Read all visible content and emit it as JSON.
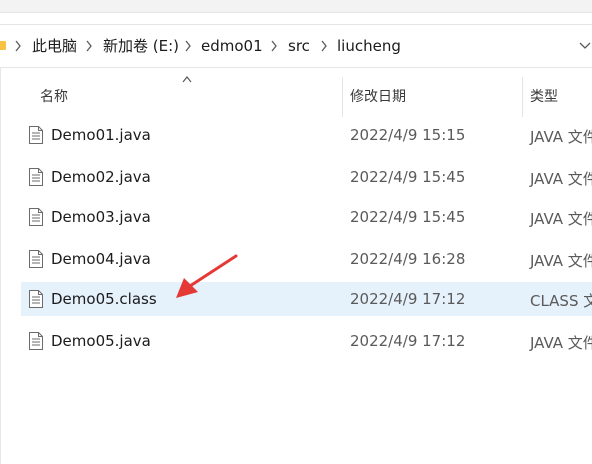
{
  "breadcrumb": {
    "items": [
      "此电脑",
      "新加卷 (E:)",
      "edmo01",
      "src",
      "liucheng"
    ]
  },
  "columns": {
    "name": "名称",
    "modified": "修改日期",
    "type": "类型"
  },
  "files": [
    {
      "name": "Demo01.java",
      "modified": "2022/4/9 15:15",
      "type": "JAVA 文件",
      "selected": false
    },
    {
      "name": "Demo02.java",
      "modified": "2022/4/9 15:45",
      "type": "JAVA 文件",
      "selected": false
    },
    {
      "name": "Demo03.java",
      "modified": "2022/4/9 15:45",
      "type": "JAVA 文件",
      "selected": false
    },
    {
      "name": "Demo04.java",
      "modified": "2022/4/9 16:28",
      "type": "JAVA 文件",
      "selected": false
    },
    {
      "name": "Demo05.class",
      "modified": "2022/4/9 17:12",
      "type": "CLASS 文件",
      "selected": true
    },
    {
      "name": "Demo05.java",
      "modified": "2022/4/9 17:12",
      "type": "JAVA 文件",
      "selected": false
    }
  ],
  "colors": {
    "selection": "#e5f1fb",
    "annotation": "#e53935",
    "folder": "#f6c343"
  },
  "icons": {
    "folder": "folder-icon",
    "file": "document-icon",
    "separator": "chevron-right-icon",
    "dropdown": "chevron-down-icon",
    "sort": "sort-up-icon"
  }
}
